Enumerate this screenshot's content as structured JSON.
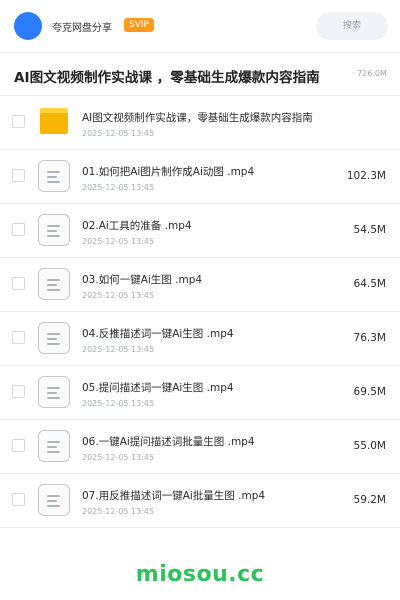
{
  "header": {
    "share_name": "夸克网盘分享",
    "badge": "SVIP",
    "search_label": "搜索",
    "colors": {
      "avatar": "#2b7cff",
      "badge": "#ff9b1a"
    }
  },
  "folder": {
    "title": "AI图文视频制作实战课 ，零基础生成爆款内容指南",
    "total_size": "· 726.0M"
  },
  "items": [
    {
      "type": "folder",
      "name": "AI图文视频制作实战课，零基础生成爆款内容指南",
      "date": "2025-12-05 13:45",
      "size": ""
    },
    {
      "type": "file",
      "name": "01.如何把Ai图片制作成Ai动图 .mp4",
      "date": "2025-12-05 13:45",
      "size": "102.3M"
    },
    {
      "type": "file",
      "name": "02.Ai工具的准备 .mp4",
      "date": "2025-12-05 13:45",
      "size": "54.5M"
    },
    {
      "type": "file",
      "name": "03.如何一键Ai生图 .mp4",
      "date": "2025-12-05 13:45",
      "size": "64.5M"
    },
    {
      "type": "file",
      "name": "04.反推描述词一键Ai生图 .mp4",
      "date": "2025-12-05 13:45",
      "size": "76.3M"
    },
    {
      "type": "file",
      "name": "05.提问描述词一键Ai生图 .mp4",
      "date": "2025-12-05 13:45",
      "size": "69.5M"
    },
    {
      "type": "file",
      "name": "06.一键Ai提问描述词批量生图 .mp4",
      "date": "2025-12-05 13:45",
      "size": "55.0M"
    },
    {
      "type": "file",
      "name": "07.用反推描述词一键Ai批量生图 .mp4",
      "date": "2025-12-05 13:45",
      "size": "59.2M"
    }
  ],
  "watermark": "miosou.cc"
}
